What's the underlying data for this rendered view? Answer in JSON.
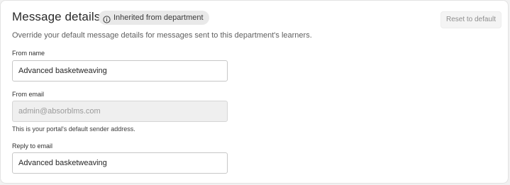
{
  "section": {
    "title": "Message details",
    "badge": {
      "icon": "info-icon",
      "label": "Inherited from department"
    },
    "reset_label": "Reset to default",
    "description": "Override your default message details for messages sent to this department's learners."
  },
  "fields": {
    "from_name": {
      "label": "From name",
      "value": "Advanced basketweaving"
    },
    "from_email": {
      "label": "From email",
      "value": "admin@absorblms.com",
      "helper": "This is your portal's default sender address."
    },
    "reply_to": {
      "label": "Reply to email",
      "value": "Advanced basketweaving"
    }
  }
}
